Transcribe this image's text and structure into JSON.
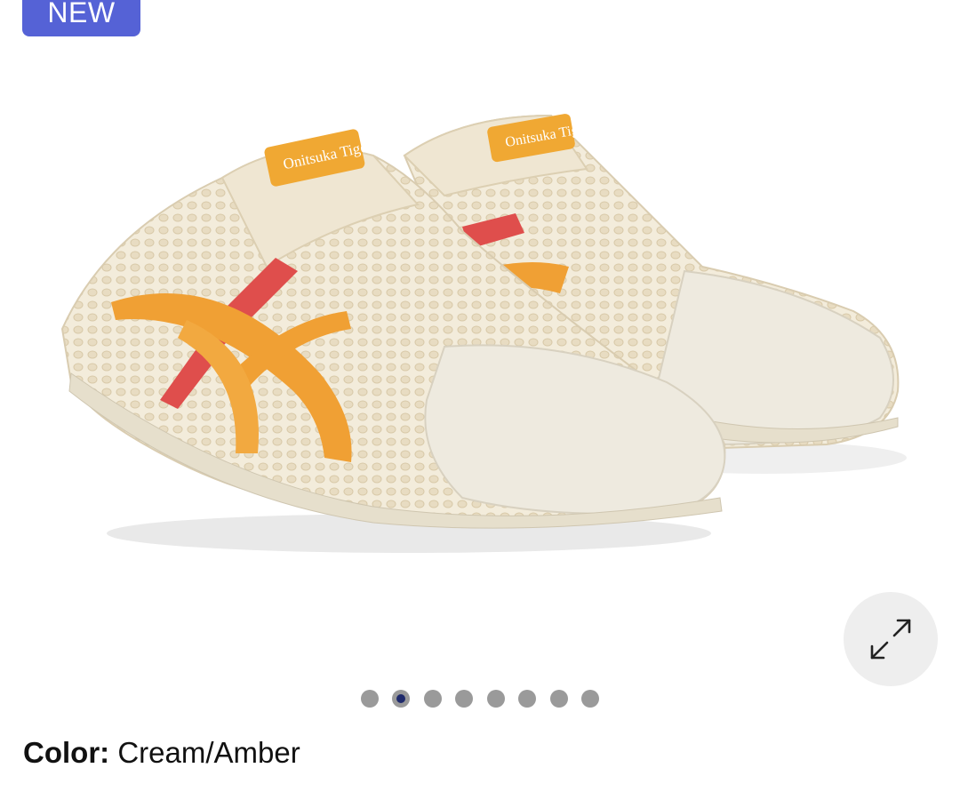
{
  "badge": {
    "label": "NEW",
    "color": "#5562d6"
  },
  "product": {
    "image_alt": "Cream/Amber mesh slip-on sneakers",
    "brand_tag": "Onitsuka Tiger",
    "colors": {
      "cream": "#f1ebdc",
      "amber": "#f0a034",
      "red_stripe": "#df4e4c"
    }
  },
  "gallery": {
    "dot_count": 8,
    "active_index": 1,
    "expand_icon": "expand-arrows-icon"
  },
  "color_info": {
    "label": "Color:",
    "value": "Cream/Amber"
  }
}
